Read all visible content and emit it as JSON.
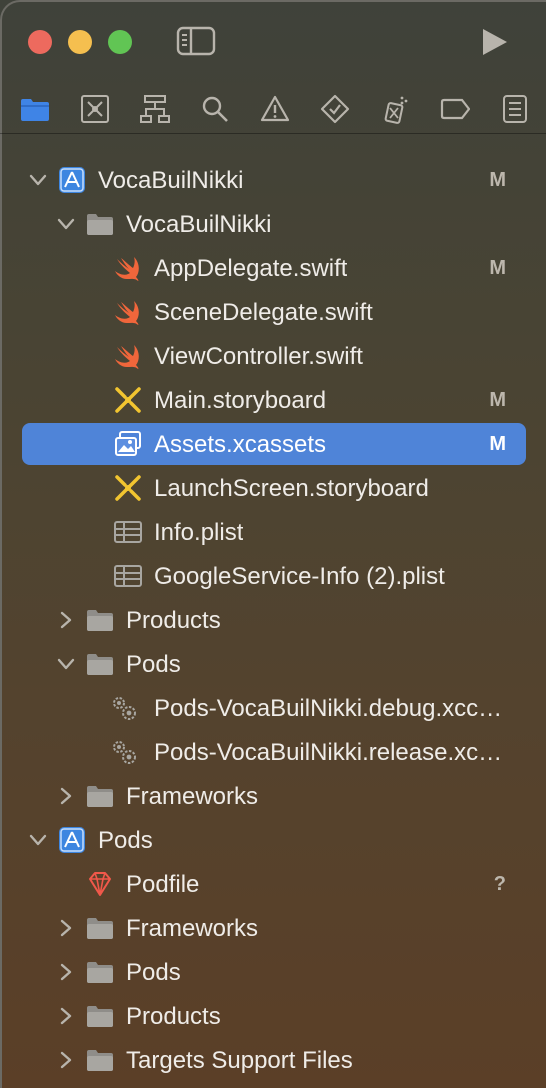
{
  "window": {
    "controls": [
      "close",
      "minimize",
      "zoom"
    ]
  },
  "toolbar": {
    "icons": [
      "sidebar-toggle-icon",
      "run-icon"
    ]
  },
  "navigator_tabs": [
    "project-navigator-icon",
    "source-control-icon",
    "symbol-navigator-icon",
    "find-navigator-icon",
    "issue-navigator-icon",
    "test-navigator-icon",
    "debug-navigator-icon",
    "breakpoint-navigator-icon",
    "report-navigator-icon"
  ],
  "accent": "#4f84d8",
  "tree": [
    {
      "label": "VocaBuilNikki",
      "badge": "M"
    },
    {
      "label": "VocaBuilNikki",
      "badge": ""
    },
    {
      "label": "AppDelegate.swift",
      "badge": "M"
    },
    {
      "label": "SceneDelegate.swift",
      "badge": ""
    },
    {
      "label": "ViewController.swift",
      "badge": ""
    },
    {
      "label": "Main.storyboard",
      "badge": "M"
    },
    {
      "label": "Assets.xcassets",
      "badge": "M"
    },
    {
      "label": "LaunchScreen.storyboard",
      "badge": ""
    },
    {
      "label": "Info.plist",
      "badge": ""
    },
    {
      "label": "GoogleService-Info (2).plist",
      "badge": ""
    },
    {
      "label": "Products",
      "badge": ""
    },
    {
      "label": "Pods",
      "badge": ""
    },
    {
      "label": "Pods-VocaBuilNikki.debug.xcconfig",
      "badge": ""
    },
    {
      "label": "Pods-VocaBuilNikki.release.xcconfig",
      "badge": ""
    },
    {
      "label": "Frameworks",
      "badge": ""
    },
    {
      "label": "Pods",
      "badge": ""
    },
    {
      "label": "Podfile",
      "badge": "?"
    },
    {
      "label": "Frameworks",
      "badge": ""
    },
    {
      "label": "Pods",
      "badge": ""
    },
    {
      "label": "Products",
      "badge": ""
    },
    {
      "label": "Targets Support Files",
      "badge": ""
    }
  ]
}
